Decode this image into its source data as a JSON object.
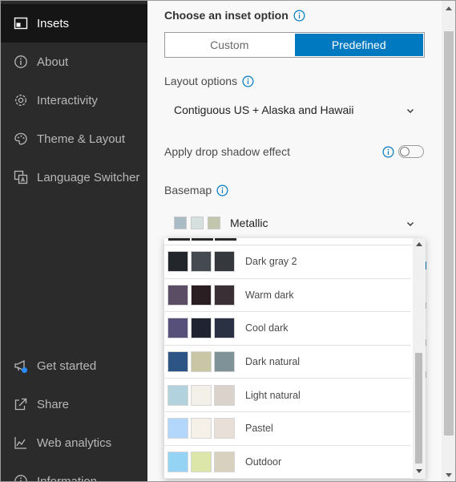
{
  "sidebar": {
    "items": [
      {
        "label": "Insets",
        "icon": "inset-map-icon"
      },
      {
        "label": "About",
        "icon": "info-icon"
      },
      {
        "label": "Interactivity",
        "icon": "gear-icon"
      },
      {
        "label": "Theme & Layout",
        "icon": "palette-icon"
      },
      {
        "label": "Language Switcher",
        "icon": "translate-icon"
      }
    ],
    "bottom_items": [
      {
        "label": "Get started",
        "icon": "megaphone-icon"
      },
      {
        "label": "Share",
        "icon": "share-icon"
      },
      {
        "label": "Web analytics",
        "icon": "chart-icon"
      },
      {
        "label": "Information",
        "icon": "info-icon"
      }
    ]
  },
  "inset_option": {
    "title": "Choose an inset option",
    "options": [
      "Custom",
      "Predefined"
    ],
    "selected": "Predefined"
  },
  "layout_options": {
    "label": "Layout options",
    "value": "Contiguous US + Alaska and Hawaii"
  },
  "shadow": {
    "label": "Apply drop shadow effect",
    "enabled": false
  },
  "basemap": {
    "label": "Basemap",
    "value": "Metallic",
    "value_swatches": [
      "#a9bcc5",
      "#d6e0df",
      "#c2c6ac"
    ],
    "options": [
      {
        "label": "Dark gray 2",
        "swatches": [
          "#23272b",
          "#454a51",
          "#35383d"
        ]
      },
      {
        "label": "Warm dark",
        "swatches": [
          "#5b4e64",
          "#2a1e22",
          "#3a2f35"
        ]
      },
      {
        "label": "Cool dark",
        "swatches": [
          "#56507a",
          "#1f2332",
          "#2a3142"
        ]
      },
      {
        "label": "Dark natural",
        "swatches": [
          "#2c5485",
          "#c8c6a5",
          "#7f9298"
        ]
      },
      {
        "label": "Light natural",
        "swatches": [
          "#b2d3de",
          "#f3f0e9",
          "#d9d3cc"
        ]
      },
      {
        "label": "Pastel",
        "swatches": [
          "#b3d7fb",
          "#f5f1e9",
          "#e8dfd9"
        ]
      },
      {
        "label": "Outdoor",
        "swatches": [
          "#94d3f3",
          "#dbe6a8",
          "#d9d1bf"
        ]
      }
    ]
  },
  "colors": {
    "accent": "#0079c1",
    "sidebar_bg": "#2b2b2b",
    "sidebar_active_bg": "#151515",
    "notification_dot": "#2a8cff"
  }
}
